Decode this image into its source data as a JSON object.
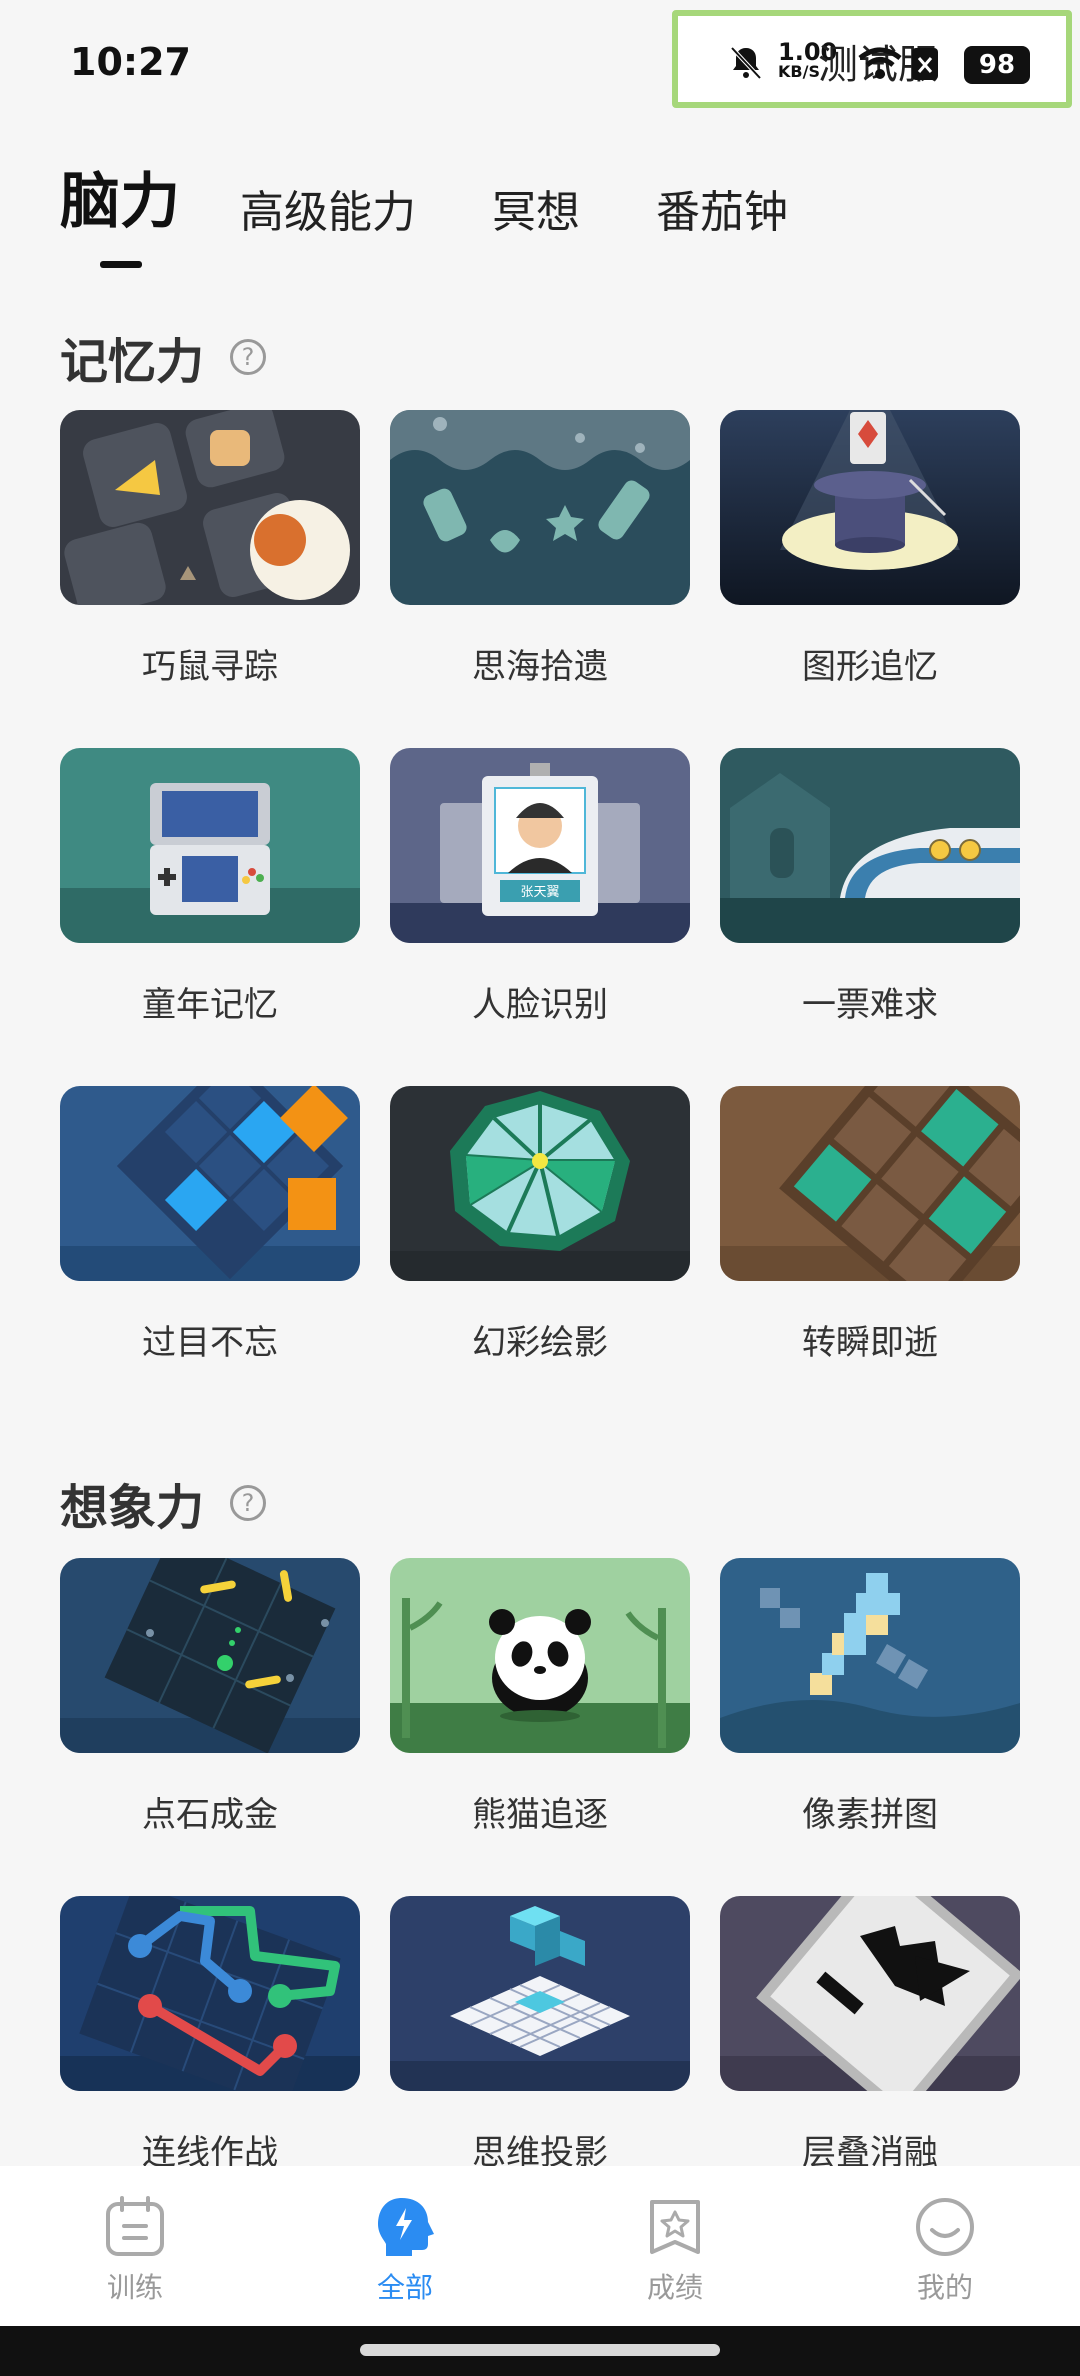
{
  "status_bar": {
    "time": "10:27",
    "overlay_label": "测试服",
    "speed_value": "1.00",
    "speed_unit": "KB/S",
    "battery": "98",
    "icons": [
      "bell-muted-icon",
      "wifi-icon",
      "sim-off-icon",
      "battery-icon"
    ]
  },
  "tabs": [
    {
      "label": "脑力",
      "active": true
    },
    {
      "label": "高级能力",
      "active": false
    },
    {
      "label": "冥想",
      "active": false
    },
    {
      "label": "番茄钟",
      "active": false
    }
  ],
  "sections": [
    {
      "title": "记忆力",
      "help": "?",
      "items": [
        "巧鼠寻踪",
        "思海拾遗",
        "图形追忆",
        "童年记忆",
        "人脸识别",
        "一票难求",
        "过目不忘",
        "幻彩绘影",
        "转瞬即逝"
      ]
    },
    {
      "title": "想象力",
      "help": "?",
      "items": [
        "点石成金",
        "熊猫追逐",
        "像素拼图",
        "连线作战",
        "思维投影",
        "层叠消融"
      ]
    }
  ],
  "thumb_text": {
    "face_name": "张天翼"
  },
  "bottom_nav": [
    {
      "label": "训练",
      "icon": "calendar-icon",
      "active": false
    },
    {
      "label": "全部",
      "icon": "brain-icon",
      "active": true
    },
    {
      "label": "成绩",
      "icon": "star-badge-icon",
      "active": false
    },
    {
      "label": "我的",
      "icon": "smile-icon",
      "active": false
    }
  ],
  "colors": {
    "accent": "#2b8cf2",
    "background": "#f6f6f6"
  }
}
